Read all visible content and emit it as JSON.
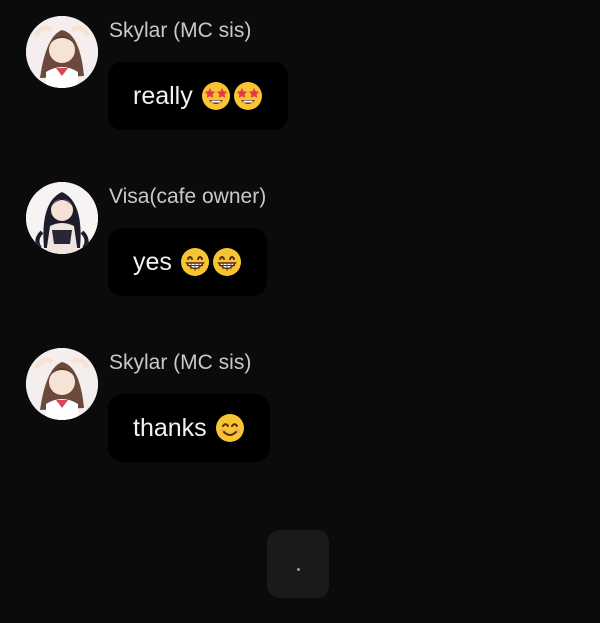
{
  "messages": [
    {
      "sender": "Skylar (MC sis)",
      "avatar_icon": "avatar-skylar",
      "text": "really",
      "emojis": [
        "star-struck-emoji",
        "star-struck-emoji"
      ]
    },
    {
      "sender": "Visa(cafe owner)",
      "avatar_icon": "avatar-visa",
      "text": "yes",
      "emojis": [
        "grinning-emoji",
        "grinning-emoji"
      ]
    },
    {
      "sender": "Skylar (MC sis)",
      "avatar_icon": "avatar-skylar",
      "text": "thanks",
      "emojis": [
        "smiling-emoji"
      ]
    }
  ],
  "typing_indicator": {
    "text": "."
  },
  "colors": {
    "background": "#0b0b0b",
    "bubble": "#000000",
    "sender_name": "#c9c9c9",
    "emoji_yellow": "#f7c531"
  }
}
